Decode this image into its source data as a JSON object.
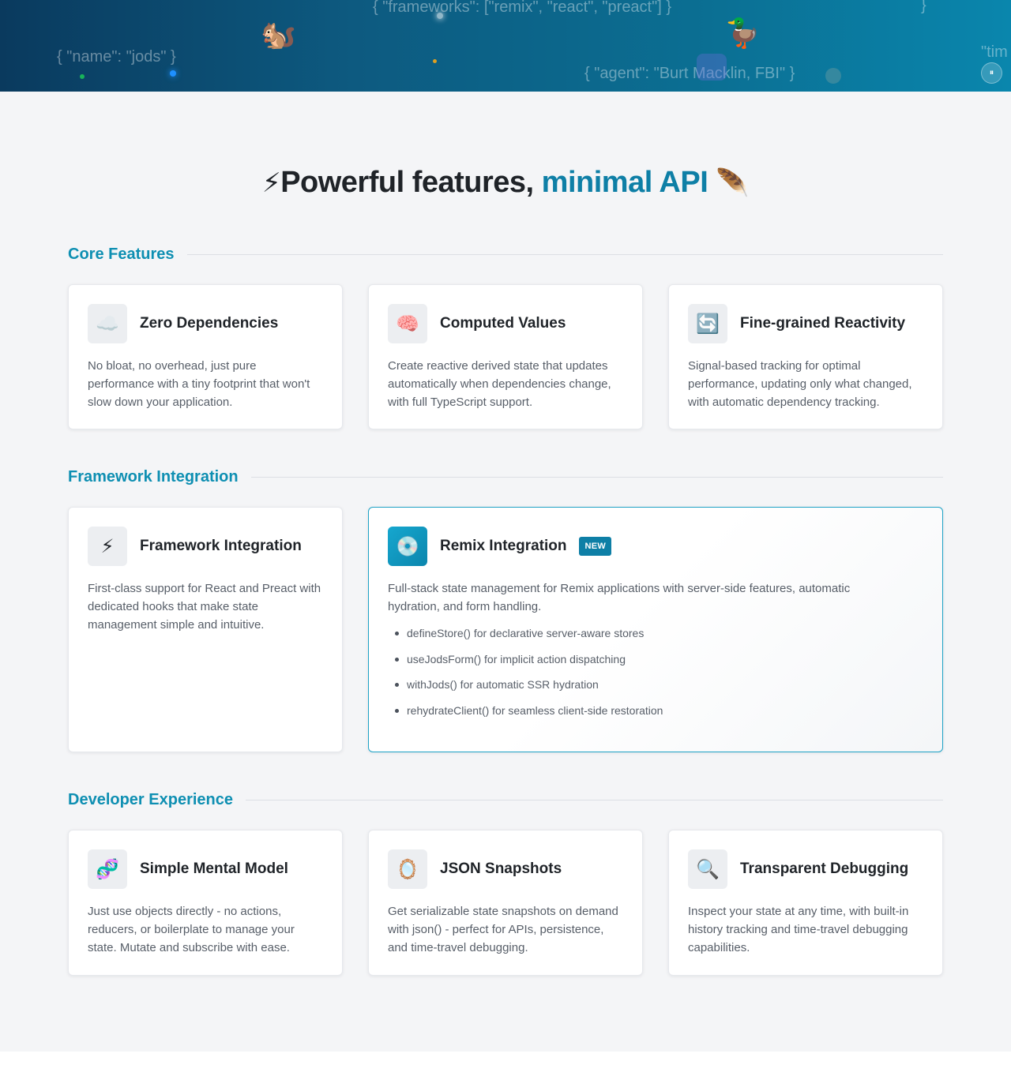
{
  "hero": {
    "snippets": [
      "{ \"frameworks\": [\"remix\", \"react\", \"preact\"] }",
      "{ \"name\": \"jods\" }",
      "{ \"agent\": \"Burt Macklin, FBI\" }",
      "}",
      "\"tim"
    ],
    "emojis": [
      "🐿️",
      "🦆"
    ],
    "pause_icon": "pause-icon",
    "pause_symbol": "⏸"
  },
  "header": {
    "title_emoji": "⚡",
    "title_main": "Powerful features,",
    "title_accent": "minimal API",
    "title_accent_emoji": "🪶"
  },
  "sections": [
    {
      "title": "Core Features",
      "cards": [
        {
          "icon": "☁️",
          "icon_name": "cloud-icon",
          "title": "Zero Dependencies",
          "desc": "No bloat, no overhead, just pure performance with a tiny footprint that won't slow down your application."
        },
        {
          "icon": "🧠",
          "icon_name": "brain-icon",
          "title": "Computed Values",
          "desc": "Create reactive derived state that updates automatically when dependencies change, with full TypeScript support."
        },
        {
          "icon": "🔄",
          "icon_name": "refresh-icon",
          "title": "Fine-grained Reactivity",
          "desc": "Signal-based tracking for optimal performance, updating only what changed, with automatic dependency tracking."
        }
      ]
    },
    {
      "title": "Framework Integration",
      "cards": [
        {
          "icon": "⚡",
          "icon_name": "lightning-icon",
          "title": "Framework Integration",
          "desc": "First-class support for React and Preact with dedicated hooks that make state management simple and intuitive."
        },
        {
          "icon": "💿",
          "icon_name": "disc-icon",
          "title": "Remix Integration",
          "badge": "NEW",
          "desc": "Full-stack state management for Remix applications with server-side features, automatic hydration, and form handling.",
          "bullets": [
            "defineStore() for declarative server-aware stores",
            "useJodsForm() for implicit action dispatching",
            "withJods() for automatic SSR hydration",
            "rehydrateClient() for seamless client-side restoration"
          ]
        }
      ]
    },
    {
      "title": "Developer Experience",
      "cards": [
        {
          "icon": "🧬",
          "icon_name": "dna-icon",
          "title": "Simple Mental Model",
          "desc": "Just use objects directly - no actions, reducers, or boilerplate to manage your state. Mutate and subscribe with ease."
        },
        {
          "icon": "🪞",
          "icon_name": "mirror-icon",
          "title": "JSON Snapshots",
          "desc": "Get serializable state snapshots on demand with json() - perfect for APIs, persistence, and time-travel debugging."
        },
        {
          "icon": "🔍",
          "icon_name": "magnifier-icon",
          "title": "Transparent Debugging",
          "desc": "Inspect your state at any time, with built-in history tracking and time-travel debugging capabilities."
        }
      ]
    }
  ]
}
